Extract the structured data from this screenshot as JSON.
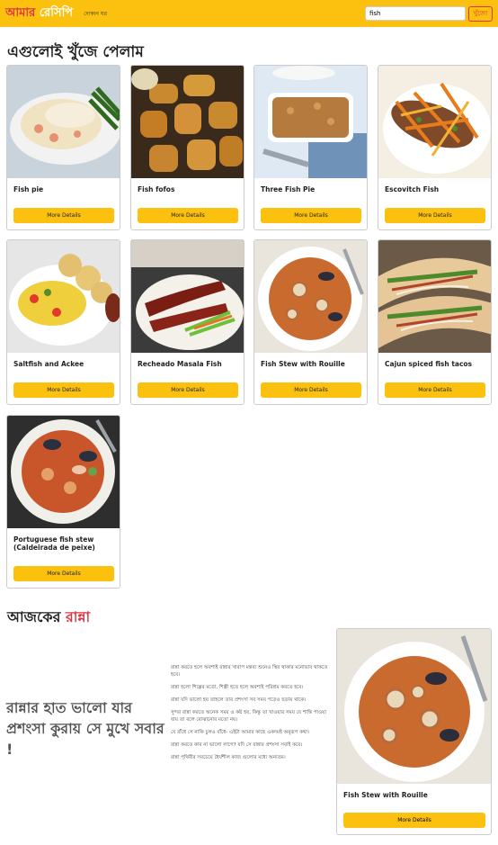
{
  "navbar": {
    "brand_part1": "আমার",
    "brand_part2": "রেসিপি",
    "nav_link": "দোকান ঘর",
    "search_value": "fish",
    "search_button": "খুঁজো"
  },
  "results": {
    "title": "এগুলোই খুঁজে পেলাম",
    "button_label": "More Details",
    "items": [
      {
        "title": "Fish pie"
      },
      {
        "title": "Fish fofos"
      },
      {
        "title": "Three Fish Pie"
      },
      {
        "title": "Escovitch Fish"
      },
      {
        "title": "Saltfish and Ackee"
      },
      {
        "title": "Recheado Masala Fish"
      },
      {
        "title": "Fish Stew with Rouille"
      },
      {
        "title": "Cajun spiced fish tacos"
      },
      {
        "title": "Portuguese fish stew (Caldeirada de peixe)"
      }
    ]
  },
  "today": {
    "title_part1": "আজকের",
    "title_part2": "রান্না",
    "quote": "রান্নার হাত ভালো যার প্রশংসা কুরায় সে মুখে সবার !",
    "paragraphs": [
      "রান্না করতে হলে অবশ্যই রান্নার খারাপ মন্তব্য শুনেও স্থির থাকার মনোভাব থাকতে হবে।",
      "রান্না হলো শিল্পের মতো, শিল্পী হতে হলে অবশ্যই পরিশ্রম করতে হবে।",
      "রান্না যদি ভালো হয় তাহলে তার প্রশংসা সব সময় পড়েও ছড়ায় থাকে।",
      "সুন্দর রান্না করতে অনেক সময় ও কষ্ট হয়, কিন্তু তা খাওয়ার সময় যে শান্তি পাওয়া যায় তা বলে বোঝানোর মতো নয়।",
      "যে রাঁধে সে নাকি চুলও বাঁধে- এইটা আমার কাছে একদমই অনুরূপ কথা।",
      "রান্না করতে কার না ভালো লাগে? যদি সে রান্নার প্রশংসা সবাই করে।",
      "রান্না পৃথিবীর সবচেয়ে ধৈর্যশীল কাজ গুলোর মধ্যে অন্যতম।"
    ],
    "feature": {
      "title": "Fish Stew with Rouille",
      "button_label": "More Details"
    }
  },
  "colors": {
    "accent": "#fbc10e",
    "brand_red": "#dc3545"
  }
}
